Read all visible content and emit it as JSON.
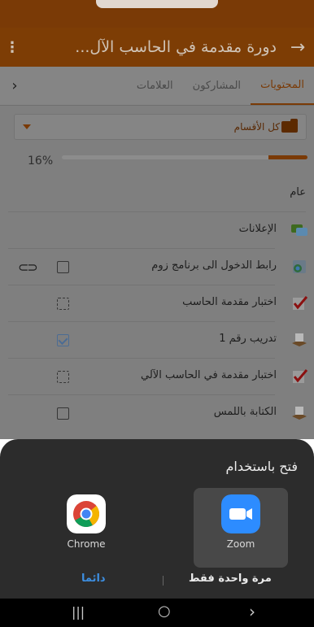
{
  "appbar": {
    "title": "دورة مقدمة في الحاسب الآل...",
    "back_icon": "arrow-right-icon",
    "menu_icon": "more-vert-icon"
  },
  "tabs": [
    {
      "label": "المحتويات",
      "active": true
    },
    {
      "label": "المشاركون",
      "active": false
    },
    {
      "label": "العلامات",
      "active": false
    }
  ],
  "section_dropdown": {
    "label": "كل الأقسام"
  },
  "progress": {
    "percent_label": "16%",
    "value": 0.16
  },
  "general_label": "عام",
  "items": [
    {
      "label": "الإعلانات",
      "icon": "forum-icon",
      "check": "none"
    },
    {
      "label": "رابط الدخول الى برنامج زوم",
      "icon": "url-icon",
      "check": "empty",
      "link_icon": "link-icon"
    },
    {
      "label": "اختبار مقدمة الحاسب",
      "icon": "quiz-icon",
      "check": "dashed"
    },
    {
      "label": "تدريب رقم 1",
      "icon": "assignment-icon",
      "check": "checked"
    },
    {
      "label": "اختبار مقدمة في الحاسب الآلي",
      "icon": "quiz-icon",
      "check": "dashed"
    },
    {
      "label": "الكتابة باللمس",
      "icon": "assignment-icon",
      "check": "empty"
    }
  ],
  "open_with": {
    "title": "فتح باستخدام",
    "apps": [
      {
        "label": "Chrome",
        "icon": "chrome-icon"
      },
      {
        "label": "Zoom",
        "icon": "zoom-icon",
        "selected": true
      }
    ],
    "once_label": "مرة واحدة فقط",
    "always_label": "دائما"
  },
  "navbar": {
    "recents": "|||",
    "home": "○",
    "back": "›"
  },
  "colors": {
    "brand": "#7a3a06",
    "accent_blue": "#3d8ee0",
    "zoom_blue": "#2d8cff"
  }
}
